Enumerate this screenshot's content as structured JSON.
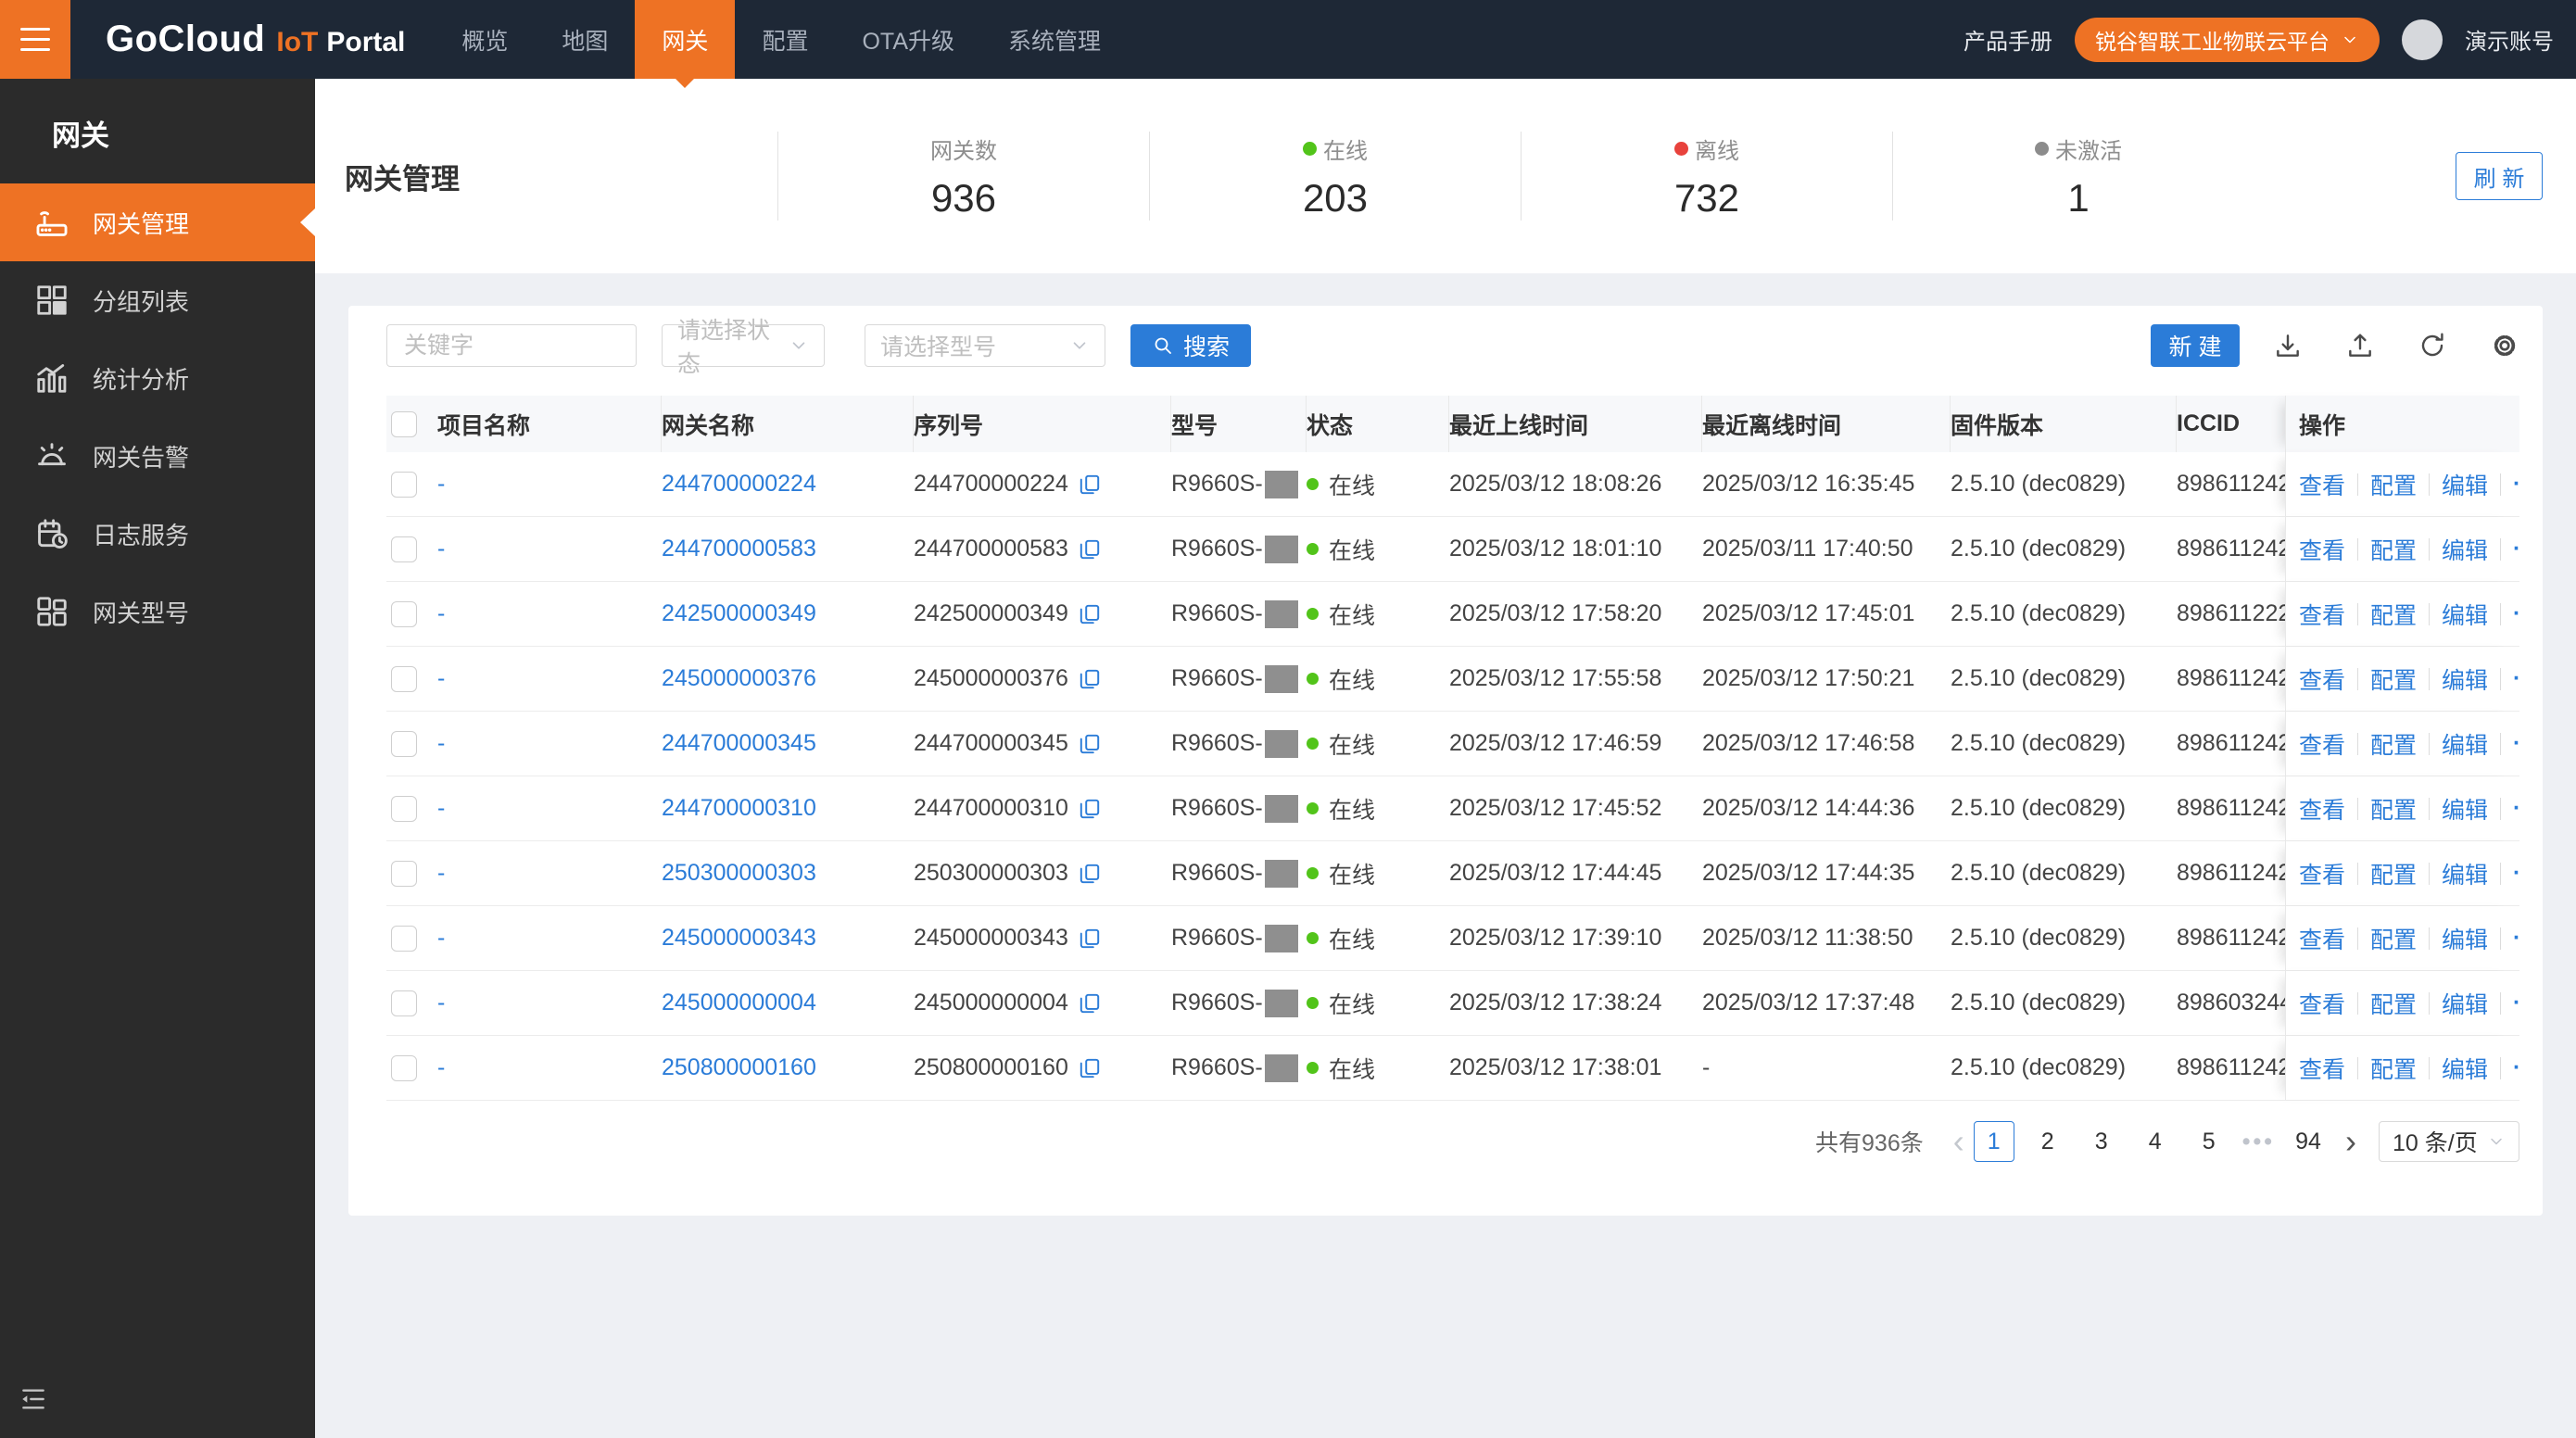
{
  "topbar": {
    "logo_primary": "GoCloud",
    "logo_accent": "IoT",
    "logo_suffix": "Portal",
    "nav_items": [
      {
        "label": "概览",
        "active": false
      },
      {
        "label": "地图",
        "active": false
      },
      {
        "label": "网关",
        "active": true
      },
      {
        "label": "配置",
        "active": false
      },
      {
        "label": "OTA升级",
        "active": false
      },
      {
        "label": "系统管理",
        "active": false
      }
    ],
    "manual_link": "产品手册",
    "platform_button": "锐谷智联工业物联云平台",
    "account_name": "演示账号"
  },
  "sidebar": {
    "title": "网关",
    "items": [
      {
        "label": "网关管理",
        "icon": "gateway-router-icon",
        "active": true
      },
      {
        "label": "分组列表",
        "icon": "group-grid-icon",
        "active": false
      },
      {
        "label": "统计分析",
        "icon": "stats-chart-icon",
        "active": false
      },
      {
        "label": "网关告警",
        "icon": "alarm-siren-icon",
        "active": false
      },
      {
        "label": "日志服务",
        "icon": "log-calendar-icon",
        "active": false
      },
      {
        "label": "网关型号",
        "icon": "model-grid-icon",
        "active": false
      }
    ]
  },
  "page_header": {
    "title": "网关管理",
    "stats": [
      {
        "label": "网关数",
        "value": "936",
        "dot_color": null
      },
      {
        "label": "在线",
        "value": "203",
        "dot_color": "#52c41a"
      },
      {
        "label": "离线",
        "value": "732",
        "dot_color": "#e8423c"
      },
      {
        "label": "未激活",
        "value": "1",
        "dot_color": "#8c8c8c"
      }
    ],
    "refresh_button": "刷 新"
  },
  "toolbar": {
    "keyword_placeholder": "关键字",
    "status_placeholder": "请选择状态",
    "model_placeholder": "请选择型号",
    "search_button": "搜索",
    "create_button": "新 建"
  },
  "table": {
    "columns": {
      "project": "项目名称",
      "name": "网关名称",
      "serial": "序列号",
      "model": "型号",
      "status": "状态",
      "last_online": "最近上线时间",
      "last_offline": "最近离线时间",
      "firmware": "固件版本",
      "iccid": "ICCID",
      "actions": "操作"
    },
    "row_actions": [
      "查看",
      "配置",
      "编辑"
    ],
    "more_label": "···",
    "rows": [
      {
        "project": "-",
        "name": "244700000224",
        "serial": "244700000224",
        "model_prefix": "R9660S-",
        "status": "在线",
        "last_online": "2025/03/12 18:08:26",
        "last_offline": "2025/03/12 16:35:45",
        "firmware": "2.5.10 (dec0829)",
        "iccid": "898611242"
      },
      {
        "project": "-",
        "name": "244700000583",
        "serial": "244700000583",
        "model_prefix": "R9660S-",
        "status": "在线",
        "last_online": "2025/03/12 18:01:10",
        "last_offline": "2025/03/11 17:40:50",
        "firmware": "2.5.10 (dec0829)",
        "iccid": "898611242"
      },
      {
        "project": "-",
        "name": "242500000349",
        "serial": "242500000349",
        "model_prefix": "R9660S-",
        "status": "在线",
        "last_online": "2025/03/12 17:58:20",
        "last_offline": "2025/03/12 17:45:01",
        "firmware": "2.5.10 (dec0829)",
        "iccid": "898611222"
      },
      {
        "project": "-",
        "name": "245000000376",
        "serial": "245000000376",
        "model_prefix": "R9660S-",
        "status": "在线",
        "last_online": "2025/03/12 17:55:58",
        "last_offline": "2025/03/12 17:50:21",
        "firmware": "2.5.10 (dec0829)",
        "iccid": "898611242"
      },
      {
        "project": "-",
        "name": "244700000345",
        "serial": "244700000345",
        "model_prefix": "R9660S-",
        "status": "在线",
        "last_online": "2025/03/12 17:46:59",
        "last_offline": "2025/03/12 17:46:58",
        "firmware": "2.5.10 (dec0829)",
        "iccid": "898611242"
      },
      {
        "project": "-",
        "name": "244700000310",
        "serial": "244700000310",
        "model_prefix": "R9660S-",
        "status": "在线",
        "last_online": "2025/03/12 17:45:52",
        "last_offline": "2025/03/12 14:44:36",
        "firmware": "2.5.10 (dec0829)",
        "iccid": "898611242"
      },
      {
        "project": "-",
        "name": "250300000303",
        "serial": "250300000303",
        "model_prefix": "R9660S-",
        "status": "在线",
        "last_online": "2025/03/12 17:44:45",
        "last_offline": "2025/03/12 17:44:35",
        "firmware": "2.5.10 (dec0829)",
        "iccid": "898611242"
      },
      {
        "project": "-",
        "name": "245000000343",
        "serial": "245000000343",
        "model_prefix": "R9660S-",
        "status": "在线",
        "last_online": "2025/03/12 17:39:10",
        "last_offline": "2025/03/12 11:38:50",
        "firmware": "2.5.10 (dec0829)",
        "iccid": "898611242"
      },
      {
        "project": "-",
        "name": "245000000004",
        "serial": "245000000004",
        "model_prefix": "R9660S-",
        "status": "在线",
        "last_online": "2025/03/12 17:38:24",
        "last_offline": "2025/03/12 17:37:48",
        "firmware": "2.5.10 (dec0829)",
        "iccid": "898603244"
      },
      {
        "project": "-",
        "name": "250800000160",
        "serial": "250800000160",
        "model_prefix": "R9660S-",
        "status": "在线",
        "last_online": "2025/03/12 17:38:01",
        "last_offline": "-",
        "firmware": "2.5.10 (dec0829)",
        "iccid": "898611242"
      }
    ]
  },
  "pagination": {
    "total_text": "共有936条",
    "pages": [
      "1",
      "2",
      "3",
      "4",
      "5",
      "•••",
      "94"
    ],
    "current_page": "1",
    "page_size_label": "10 条/页"
  },
  "colors": {
    "accent_orange": "#ee7224",
    "primary_blue": "#2b7cd8",
    "online_green": "#52c41a",
    "offline_red": "#e8423c",
    "inactive_gray": "#8c8c8c"
  }
}
